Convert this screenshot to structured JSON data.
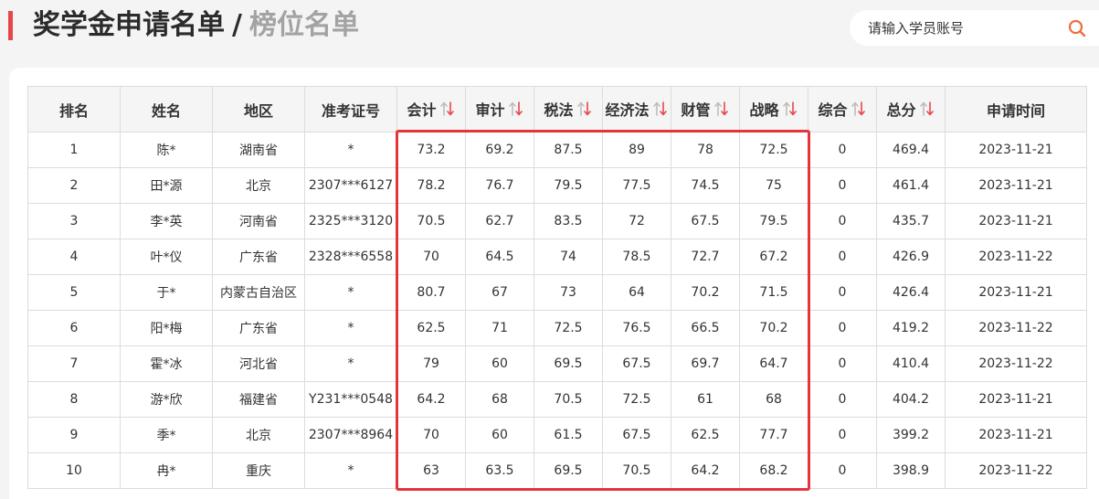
{
  "header": {
    "title_main": "奖学金申请名单",
    "title_sep": "/",
    "title_sub": "榜位名单",
    "accent_color": "#e8474a"
  },
  "search": {
    "placeholder": "请输入学员账号",
    "icon": "search-icon",
    "icon_color": "#ef6b3c"
  },
  "table": {
    "columns": [
      {
        "key": "rank",
        "label": "排名",
        "sortable": false
      },
      {
        "key": "name",
        "label": "姓名",
        "sortable": false
      },
      {
        "key": "region",
        "label": "地区",
        "sortable": false
      },
      {
        "key": "ticket",
        "label": "准考证号",
        "sortable": false
      },
      {
        "key": "accounting",
        "label": "会计",
        "sortable": true
      },
      {
        "key": "audit",
        "label": "审计",
        "sortable": true
      },
      {
        "key": "tax",
        "label": "税法",
        "sortable": true
      },
      {
        "key": "economic_law",
        "label": "经济法",
        "sortable": true
      },
      {
        "key": "finance",
        "label": "财管",
        "sortable": true
      },
      {
        "key": "strategy",
        "label": "战略",
        "sortable": true
      },
      {
        "key": "comprehensive",
        "label": "综合",
        "sortable": true
      },
      {
        "key": "total",
        "label": "总分",
        "sortable": true
      },
      {
        "key": "date",
        "label": "申请时间",
        "sortable": false
      }
    ],
    "sort_icon": "sort-updown-icon",
    "sort_colors": [
      "#bdbdbd",
      "#e8474a"
    ],
    "highlight_color": "#e4353a",
    "rows": [
      [
        "1",
        "陈*",
        "湖南省",
        "*",
        "73.2",
        "69.2",
        "87.5",
        "89",
        "78",
        "72.5",
        "0",
        "469.4",
        "2023-11-21"
      ],
      [
        "2",
        "田*源",
        "北京",
        "2307***6127",
        "78.2",
        "76.7",
        "79.5",
        "77.5",
        "74.5",
        "75",
        "0",
        "461.4",
        "2023-11-21"
      ],
      [
        "3",
        "李*英",
        "河南省",
        "2325***3120",
        "70.5",
        "62.7",
        "83.5",
        "72",
        "67.5",
        "79.5",
        "0",
        "435.7",
        "2023-11-21"
      ],
      [
        "4",
        "叶*仪",
        "广东省",
        "2328***6558",
        "70",
        "64.5",
        "74",
        "78.5",
        "72.7",
        "67.2",
        "0",
        "426.9",
        "2023-11-22"
      ],
      [
        "5",
        "于*",
        "内蒙古自治区",
        "*",
        "80.7",
        "67",
        "73",
        "64",
        "70.2",
        "71.5",
        "0",
        "426.4",
        "2023-11-21"
      ],
      [
        "6",
        "阳*梅",
        "广东省",
        "*",
        "62.5",
        "71",
        "72.5",
        "76.5",
        "66.5",
        "70.2",
        "0",
        "419.2",
        "2023-11-22"
      ],
      [
        "7",
        "霍*冰",
        "河北省",
        "*",
        "79",
        "60",
        "69.5",
        "67.5",
        "69.7",
        "64.7",
        "0",
        "410.4",
        "2023-11-22"
      ],
      [
        "8",
        "游*欣",
        "福建省",
        "Y231***0548",
        "64.2",
        "68",
        "70.5",
        "72.5",
        "61",
        "68",
        "0",
        "404.2",
        "2023-11-21"
      ],
      [
        "9",
        "季*",
        "北京",
        "2307***8964",
        "70",
        "60",
        "61.5",
        "67.5",
        "62.5",
        "77.7",
        "0",
        "399.2",
        "2023-11-21"
      ],
      [
        "10",
        "冉*",
        "重庆",
        "*",
        "63",
        "63.5",
        "69.5",
        "70.5",
        "64.2",
        "68.2",
        "0",
        "398.9",
        "2023-11-22"
      ]
    ]
  }
}
